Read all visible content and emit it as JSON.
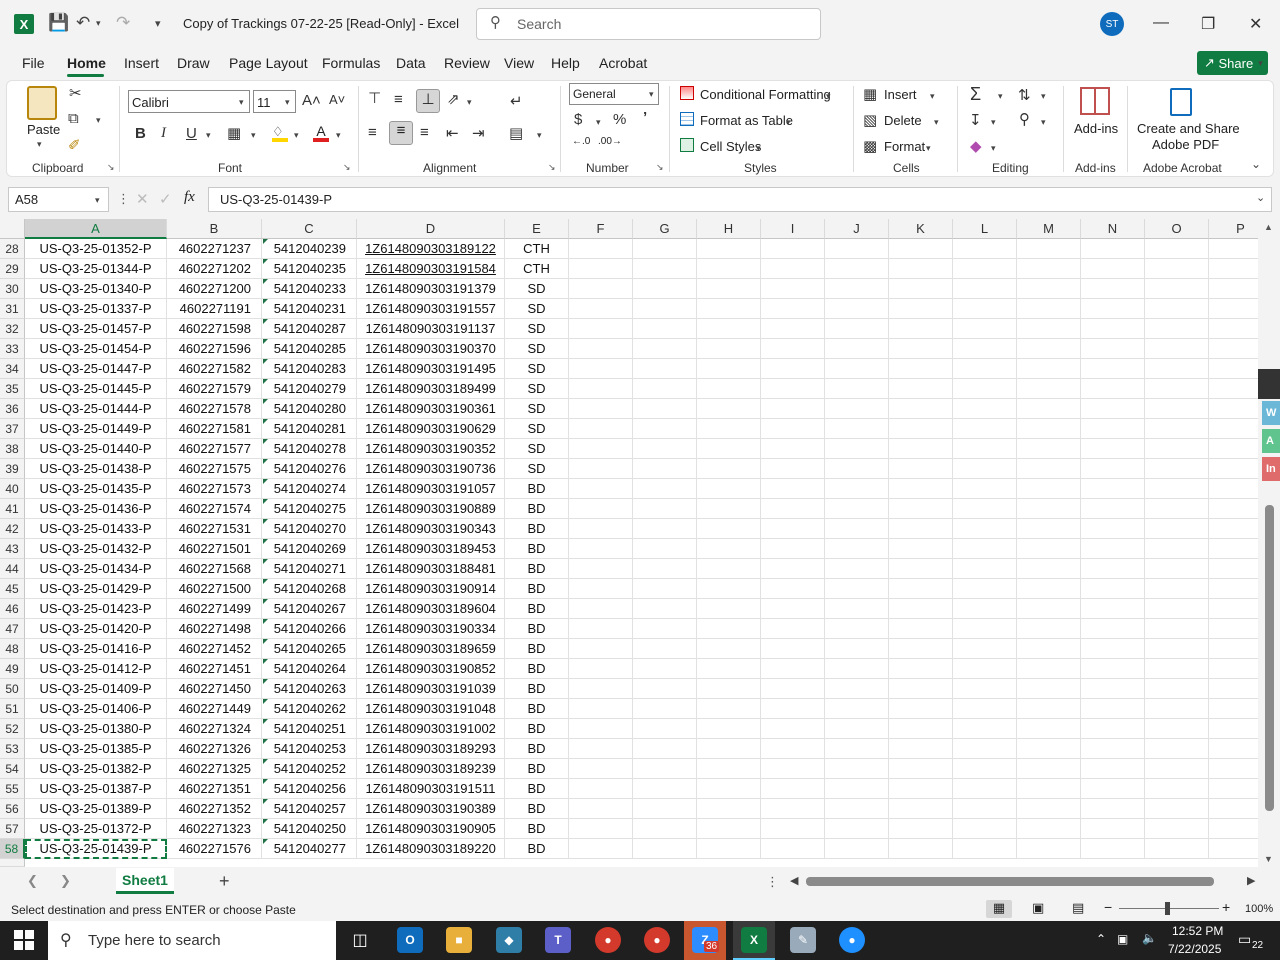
{
  "window": {
    "title": "Copy of Trackings 07-22-25  [Read-Only]  -  Excel",
    "search_placeholder": "Search",
    "avatar_initials": "ST",
    "share_label": "Share"
  },
  "menu": [
    "File",
    "Home",
    "Insert",
    "Draw",
    "Page Layout",
    "Formulas",
    "Data",
    "Review",
    "View",
    "Help",
    "Acrobat"
  ],
  "ribbon": {
    "clipboard": {
      "paste": "Paste",
      "label": "Clipboard"
    },
    "font": {
      "name": "Calibri",
      "size": "11",
      "label": "Font"
    },
    "alignment": {
      "label": "Alignment"
    },
    "number": {
      "format": "General",
      "label": "Number"
    },
    "styles": {
      "conditional": "Conditional Formatting",
      "format_table": "Format as Table",
      "cell_styles": "Cell Styles",
      "label": "Styles"
    },
    "cells": {
      "insert": "Insert",
      "delete": "Delete",
      "format": "Format",
      "label": "Cells"
    },
    "editing": {
      "label": "Editing"
    },
    "addins": {
      "button": "Add-ins",
      "label": "Add-ins"
    },
    "acrobat": {
      "button_line1": "Create and Share",
      "button_line2": "Adobe PDF",
      "label": "Adobe Acrobat"
    }
  },
  "formula_bar": {
    "name_box": "A58",
    "formula": "US-Q3-25-01439-P"
  },
  "columns": [
    "A",
    "B",
    "C",
    "D",
    "E",
    "F",
    "G",
    "H",
    "I",
    "J",
    "K",
    "L",
    "M",
    "N",
    "O",
    "P"
  ],
  "rows": [
    {
      "n": "28",
      "a": "US-Q3-25-01352-P",
      "b": "4602271237",
      "c": "5412040239",
      "d": "1Z6148090303189122",
      "e": "CTH",
      "link": true
    },
    {
      "n": "29",
      "a": "US-Q3-25-01344-P",
      "b": "4602271202",
      "c": "5412040235",
      "d": "1Z6148090303191584",
      "e": "CTH",
      "link": true
    },
    {
      "n": "30",
      "a": "US-Q3-25-01340-P",
      "b": "4602271200",
      "c": "5412040233",
      "d": "1Z6148090303191379",
      "e": "SD"
    },
    {
      "n": "31",
      "a": "US-Q3-25-01337-P",
      "b": "4602271191",
      "c": "5412040231",
      "d": "1Z6148090303191557",
      "e": "SD"
    },
    {
      "n": "32",
      "a": "US-Q3-25-01457-P",
      "b": "4602271598",
      "c": "5412040287",
      "d": "1Z6148090303191137",
      "e": "SD"
    },
    {
      "n": "33",
      "a": "US-Q3-25-01454-P",
      "b": "4602271596",
      "c": "5412040285",
      "d": "1Z6148090303190370",
      "e": "SD"
    },
    {
      "n": "34",
      "a": "US-Q3-25-01447-P",
      "b": "4602271582",
      "c": "5412040283",
      "d": "1Z6148090303191495",
      "e": "SD"
    },
    {
      "n": "35",
      "a": "US-Q3-25-01445-P",
      "b": "4602271579",
      "c": "5412040279",
      "d": "1Z6148090303189499",
      "e": "SD"
    },
    {
      "n": "36",
      "a": "US-Q3-25-01444-P",
      "b": "4602271578",
      "c": "5412040280",
      "d": "1Z6148090303190361",
      "e": "SD"
    },
    {
      "n": "37",
      "a": "US-Q3-25-01449-P",
      "b": "4602271581",
      "c": "5412040281",
      "d": "1Z6148090303190629",
      "e": "SD"
    },
    {
      "n": "38",
      "a": "US-Q3-25-01440-P",
      "b": "4602271577",
      "c": "5412040278",
      "d": "1Z6148090303190352",
      "e": "SD"
    },
    {
      "n": "39",
      "a": "US-Q3-25-01438-P",
      "b": "4602271575",
      "c": "5412040276",
      "d": "1Z6148090303190736",
      "e": "SD"
    },
    {
      "n": "40",
      "a": "US-Q3-25-01435-P",
      "b": "4602271573",
      "c": "5412040274",
      "d": "1Z6148090303191057",
      "e": "BD"
    },
    {
      "n": "41",
      "a": "US-Q3-25-01436-P",
      "b": "4602271574",
      "c": "5412040275",
      "d": "1Z6148090303190889",
      "e": "BD"
    },
    {
      "n": "42",
      "a": "US-Q3-25-01433-P",
      "b": "4602271531",
      "c": "5412040270",
      "d": "1Z6148090303190343",
      "e": "BD"
    },
    {
      "n": "43",
      "a": "US-Q3-25-01432-P",
      "b": "4602271501",
      "c": "5412040269",
      "d": "1Z6148090303189453",
      "e": "BD"
    },
    {
      "n": "44",
      "a": "US-Q3-25-01434-P",
      "b": "4602271568",
      "c": "5412040271",
      "d": "1Z6148090303188481",
      "e": "BD"
    },
    {
      "n": "45",
      "a": "US-Q3-25-01429-P",
      "b": "4602271500",
      "c": "5412040268",
      "d": "1Z6148090303190914",
      "e": "BD"
    },
    {
      "n": "46",
      "a": "US-Q3-25-01423-P",
      "b": "4602271499",
      "c": "5412040267",
      "d": "1Z6148090303189604",
      "e": "BD"
    },
    {
      "n": "47",
      "a": "US-Q3-25-01420-P",
      "b": "4602271498",
      "c": "5412040266",
      "d": "1Z6148090303190334",
      "e": "BD"
    },
    {
      "n": "48",
      "a": "US-Q3-25-01416-P",
      "b": "4602271452",
      "c": "5412040265",
      "d": "1Z6148090303189659",
      "e": "BD"
    },
    {
      "n": "49",
      "a": "US-Q3-25-01412-P",
      "b": "4602271451",
      "c": "5412040264",
      "d": "1Z6148090303190852",
      "e": "BD"
    },
    {
      "n": "50",
      "a": "US-Q3-25-01409-P",
      "b": "4602271450",
      "c": "5412040263",
      "d": "1Z6148090303191039",
      "e": "BD"
    },
    {
      "n": "51",
      "a": "US-Q3-25-01406-P",
      "b": "4602271449",
      "c": "5412040262",
      "d": "1Z6148090303191048",
      "e": "BD"
    },
    {
      "n": "52",
      "a": "US-Q3-25-01380-P",
      "b": "4602271324",
      "c": "5412040251",
      "d": "1Z6148090303191002",
      "e": "BD"
    },
    {
      "n": "53",
      "a": "US-Q3-25-01385-P",
      "b": "4602271326",
      "c": "5412040253",
      "d": "1Z6148090303189293",
      "e": "BD"
    },
    {
      "n": "54",
      "a": "US-Q3-25-01382-P",
      "b": "4602271325",
      "c": "5412040252",
      "d": "1Z6148090303189239",
      "e": "BD"
    },
    {
      "n": "55",
      "a": "US-Q3-25-01387-P",
      "b": "4602271351",
      "c": "5412040256",
      "d": "1Z6148090303191511",
      "e": "BD"
    },
    {
      "n": "56",
      "a": "US-Q3-25-01389-P",
      "b": "4602271352",
      "c": "5412040257",
      "d": "1Z6148090303190389",
      "e": "BD"
    },
    {
      "n": "57",
      "a": "US-Q3-25-01372-P",
      "b": "4602271323",
      "c": "5412040250",
      "d": "1Z6148090303190905",
      "e": "BD"
    },
    {
      "n": "58",
      "a": "US-Q3-25-01439-P",
      "b": "4602271576",
      "c": "5412040277",
      "d": "1Z6148090303189220",
      "e": "BD",
      "selected": true
    }
  ],
  "sheet_tab": "Sheet1",
  "status": {
    "message": "Select destination and press ENTER or choose Paste",
    "zoom": "100%"
  },
  "taskbar": {
    "search_placeholder": "Type here to search",
    "time": "12:52 PM",
    "date": "7/22/2025",
    "notifications": "22",
    "zoom_badge": "36"
  },
  "colors": {
    "accent": "#107c41",
    "link": "#111111"
  }
}
